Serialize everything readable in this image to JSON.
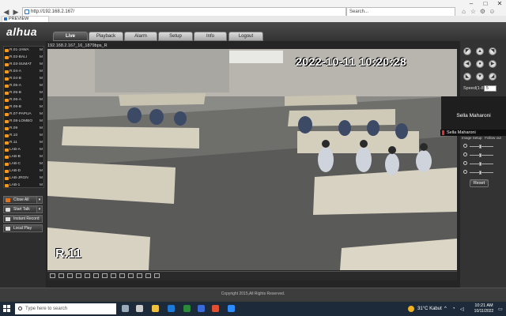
{
  "browser": {
    "url": "http://192.168.2.167/",
    "search_placeholder": "Search...",
    "tab_title": "PREVIEW"
  },
  "app": {
    "logo": "alhua",
    "nav_tabs": [
      {
        "label": "Live",
        "active": true
      },
      {
        "label": "Playback",
        "active": false
      },
      {
        "label": "Alarm",
        "active": false
      },
      {
        "label": "Setup",
        "active": false
      },
      {
        "label": "Info",
        "active": false
      },
      {
        "label": "Logout",
        "active": false
      }
    ]
  },
  "channels": [
    {
      "name": "R.01-JAWA",
      "flag": "M"
    },
    {
      "name": "R.02-BALI",
      "flag": "M"
    },
    {
      "name": "R.03-SUMAT",
      "flag": "M"
    },
    {
      "name": "R.04-A",
      "flag": "M"
    },
    {
      "name": "R.04-B",
      "flag": "M"
    },
    {
      "name": "R.05-A",
      "flag": "M"
    },
    {
      "name": "R.05-B",
      "flag": "M"
    },
    {
      "name": "R.06-A",
      "flag": "M"
    },
    {
      "name": "R.06-B",
      "flag": "M"
    },
    {
      "name": "R.07-PAPUA",
      "flag": "M"
    },
    {
      "name": "R.08-LOMBO",
      "flag": "M"
    },
    {
      "name": "R.09",
      "flag": "M"
    },
    {
      "name": "R.10",
      "flag": "M"
    },
    {
      "name": "R.11",
      "flag": "M"
    },
    {
      "name": "LAB-A",
      "flag": "M"
    },
    {
      "name": "LAB-B",
      "flag": "M"
    },
    {
      "name": "LAB-C",
      "flag": "M"
    },
    {
      "name": "LAB-D",
      "flag": "M"
    },
    {
      "name": "LAB-JRGN",
      "flag": "M"
    },
    {
      "name": "LAB-1",
      "flag": "M"
    }
  ],
  "left_buttons": {
    "close_all": "Close All",
    "start_talk": "Start Talk",
    "instant_record": "Instant Record",
    "local_play": "Local Play"
  },
  "video": {
    "stream_title": "192.168.2.167_16_1879bps_R",
    "timestamp": "2022-10-11  10:20:28",
    "camera_label": "R.11"
  },
  "ptz": {
    "speed_label": "Speed(1-8)",
    "speed_value": "5",
    "image_setup": "Image Setup",
    "follow_out": "Follow out",
    "reset_label": "Reset"
  },
  "meeting_overlay": {
    "participant_name": "Sella Maharoni",
    "participant_caption": "Sella Maharoni"
  },
  "footer": {
    "copyright": "Copyright 2015,All Rights Reserved."
  },
  "taskbar": {
    "search_placeholder": "Type here to search",
    "weather": "31°C  Kabut",
    "time": "10:21 AM",
    "date": "10/11/2022",
    "language": "ENG"
  }
}
